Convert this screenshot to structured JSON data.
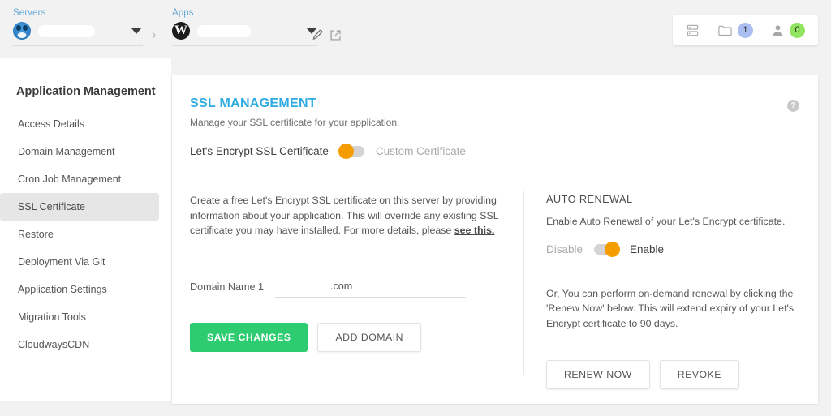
{
  "topbar": {
    "servers": {
      "label": "Servers",
      "icon": "digitalocean-avatar-icon",
      "value": "",
      "dropdown_icon": "caret-down-icon"
    },
    "separator_icon": "chevron-right-icon",
    "apps": {
      "label": "Apps",
      "icon": "wordpress-icon",
      "icon_glyph": "W",
      "value": "",
      "dropdown_icon": "caret-down-icon",
      "edit_icon": "pencil-icon",
      "launch_icon": "external-link-icon"
    },
    "actions": [
      {
        "icon": "server-stack-icon",
        "badge": null,
        "badge_color": ""
      },
      {
        "icon": "folder-icon",
        "badge": "1",
        "badge_color": "#a9bdf0"
      },
      {
        "icon": "user-icon",
        "badge": "0",
        "badge_color": "#91e45f"
      }
    ]
  },
  "sidebar": {
    "title": "Application Management",
    "items": [
      {
        "label": "Access Details",
        "active": false
      },
      {
        "label": "Domain Management",
        "active": false
      },
      {
        "label": "Cron Job Management",
        "active": false
      },
      {
        "label": "SSL Certificate",
        "active": true
      },
      {
        "label": "Restore",
        "active": false
      },
      {
        "label": "Deployment Via Git",
        "active": false
      },
      {
        "label": "Application Settings",
        "active": false
      },
      {
        "label": "Migration Tools",
        "active": false
      },
      {
        "label": "CloudwaysCDN",
        "active": false
      }
    ]
  },
  "card": {
    "title": "SSL MANAGEMENT",
    "subtitle": "Manage your SSL certificate for your application.",
    "help_icon": "question-mark-icon",
    "help_glyph": "?",
    "cert_toggle": {
      "left_label": "Let's Encrypt SSL Certificate",
      "right_label": "Custom Certificate",
      "selected": "left",
      "knob_color": "#f59c00"
    },
    "left_column": {
      "description_part1": "Create a free Let's Encrypt SSL certificate on this server by providing information about your application. This will override any existing SSL certificate you may have installed. For more details, please ",
      "link_text": "see this.",
      "domain_label": "Domain Name 1",
      "domain_value": ".com",
      "save_button": "SAVE CHANGES",
      "add_domain_button": "ADD DOMAIN"
    },
    "right_column": {
      "heading": "AUTO RENEWAL",
      "description": "Enable Auto Renewal of your Let's Encrypt certificate.",
      "toggle": {
        "left_label": "Disable",
        "right_label": "Enable",
        "selected": "right",
        "knob_color": "#f59c00"
      },
      "renew_description": "Or, You can perform on-demand renewal by clicking the 'Renew Now' below. This will extend expiry of your Let's Encrypt certificate to 90 days.",
      "renew_button": "RENEW NOW",
      "revoke_button": "REVOKE"
    }
  },
  "theme": {
    "accent_blue": "#2dabe2",
    "accent_green": "#2ecc71",
    "accent_orange": "#f59c00",
    "page_bg": "#f2f2f2"
  }
}
